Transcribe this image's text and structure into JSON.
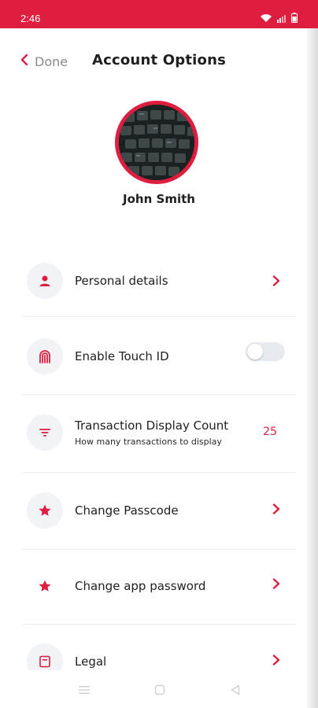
{
  "status_bar": {
    "time": "2:46",
    "background": "#df1d3f"
  },
  "header": {
    "back_label": "Done",
    "title": "Account Options"
  },
  "profile": {
    "name": "John Smith",
    "avatar_description": "keyboard-photo"
  },
  "items": [
    {
      "label": "Personal details",
      "icon": "person-icon",
      "control": "chevron"
    },
    {
      "label": "Enable Touch ID",
      "icon": "fingerprint-icon",
      "control": "toggle",
      "toggle_on": false
    },
    {
      "label": "Transaction Display Count",
      "sublabel": "How many transactions to display",
      "icon": "filter-icon",
      "control": "value",
      "value": "25"
    },
    {
      "label": "Change Passcode",
      "icon": "star-icon",
      "control": "chevron"
    },
    {
      "label": "Change app password",
      "icon": "star-icon",
      "control": "chevron"
    },
    {
      "label": "Legal",
      "icon": "document-icon",
      "control": "chevron"
    }
  ],
  "colors": {
    "accent": "#df1d3f",
    "icon_bg": "#f1f3f6",
    "text": "#1f1f1f",
    "muted": "#8a8a8a"
  },
  "nav_bar": {
    "buttons": [
      "menu-icon",
      "home-square-icon",
      "back-triangle-icon"
    ]
  }
}
